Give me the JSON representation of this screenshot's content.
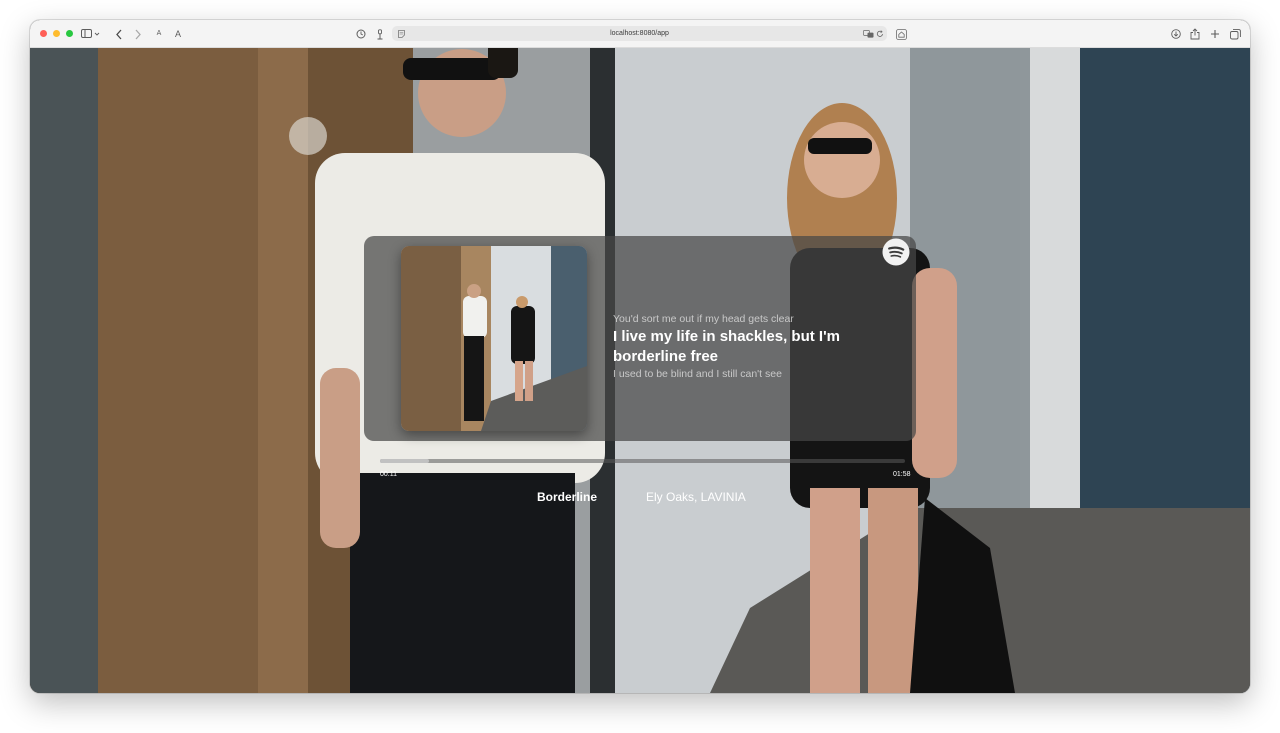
{
  "browser": {
    "url": "localhost:8080/app",
    "toolbar_icons": [
      "sidebar-icon",
      "back-icon",
      "forward-icon",
      "text-smaller-icon",
      "text-larger-icon",
      "history-icon",
      "extension-icon",
      "reader-icon",
      "translate-icon",
      "reload-icon",
      "home-icon",
      "download-icon",
      "share-icon",
      "new-tab-icon",
      "tabs-overview-icon"
    ],
    "text_small_label": "A",
    "text_large_label": "A"
  },
  "player": {
    "service_icon": "spotify-icon",
    "lyrics": {
      "previous": "You'd sort me out if my head gets clear",
      "current": "I live my life in shackles, but I'm borderline free",
      "next": "I used to be blind and I still can't see"
    },
    "elapsed": "00:11",
    "duration": "01:58",
    "progress_fraction": 0.093,
    "title": "Borderline",
    "artist": "Ely Oaks, LAVINIA"
  },
  "colors": {
    "spotify_badge": "#f2f2f2",
    "card_bg": "rgba(70,70,70,0.72)",
    "text": "#ffffff"
  }
}
